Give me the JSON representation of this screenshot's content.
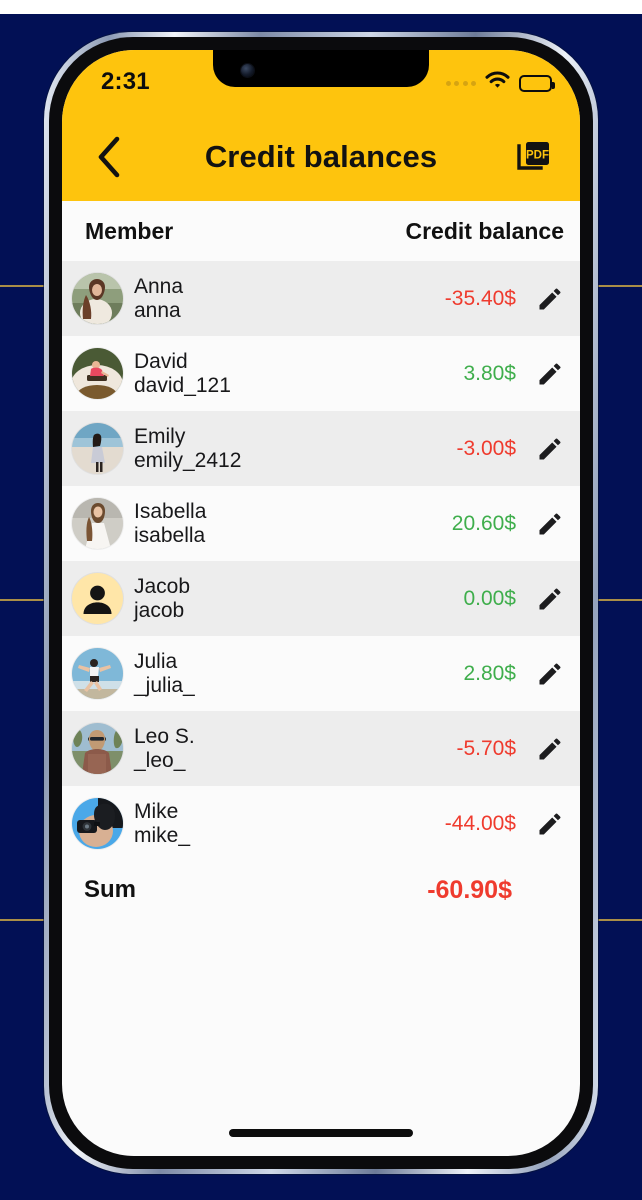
{
  "background": {
    "color": "#021055",
    "accent_line_color": "#c8a545"
  },
  "device": {
    "frame_color": "#8c9ab4",
    "home_indicator": "home-indicator"
  },
  "status_bar": {
    "time": "2:31",
    "signal_icon": "signal-dots-icon",
    "wifi_icon": "wifi-icon",
    "battery_icon": "battery-full-icon"
  },
  "nav": {
    "back_icon": "chevron-left-icon",
    "title": "Credit balances",
    "pdf_icon": "pdf-export-icon",
    "pdf_label": "PDF",
    "bar_color": "#fec40d"
  },
  "table": {
    "headers": {
      "member": "Member",
      "balance": "Credit balance"
    },
    "rows": [
      {
        "name": "Anna",
        "handle": "anna",
        "balance": "-35.40$",
        "sign": "neg",
        "avatar": "photo-woman-field"
      },
      {
        "name": "David",
        "handle": "david_121",
        "balance": "3.80$",
        "sign": "pos",
        "avatar": "photo-man-boat"
      },
      {
        "name": "Emily",
        "handle": "emily_2412",
        "balance": "-3.00$",
        "sign": "neg",
        "avatar": "photo-woman-beach"
      },
      {
        "name": "Isabella",
        "handle": "isabella",
        "balance": "20.60$",
        "sign": "pos",
        "avatar": "photo-woman-white-dress"
      },
      {
        "name": "Jacob",
        "handle": "jacob",
        "balance": "0.00$",
        "sign": "pos",
        "avatar": "placeholder-person"
      },
      {
        "name": "Julia",
        "handle": "_julia_",
        "balance": "2.80$",
        "sign": "pos",
        "avatar": "photo-woman-jumping"
      },
      {
        "name": "Leo S.",
        "handle": "_leo_",
        "balance": "-5.70$",
        "sign": "neg",
        "avatar": "photo-man-hat"
      },
      {
        "name": "Mike",
        "handle": "mike_",
        "balance": "-44.00$",
        "sign": "neg",
        "avatar": "photo-man-camera"
      }
    ],
    "edit_icon": "pencil-edit-icon"
  },
  "summary": {
    "label": "Sum",
    "value": "-60.90$",
    "sign": "neg"
  },
  "colors": {
    "positive": "#3fae4c",
    "negative": "#ef3b2e",
    "accent": "#fec40d",
    "row_alt": "#ededed",
    "row_base": "#fbfbfb"
  }
}
